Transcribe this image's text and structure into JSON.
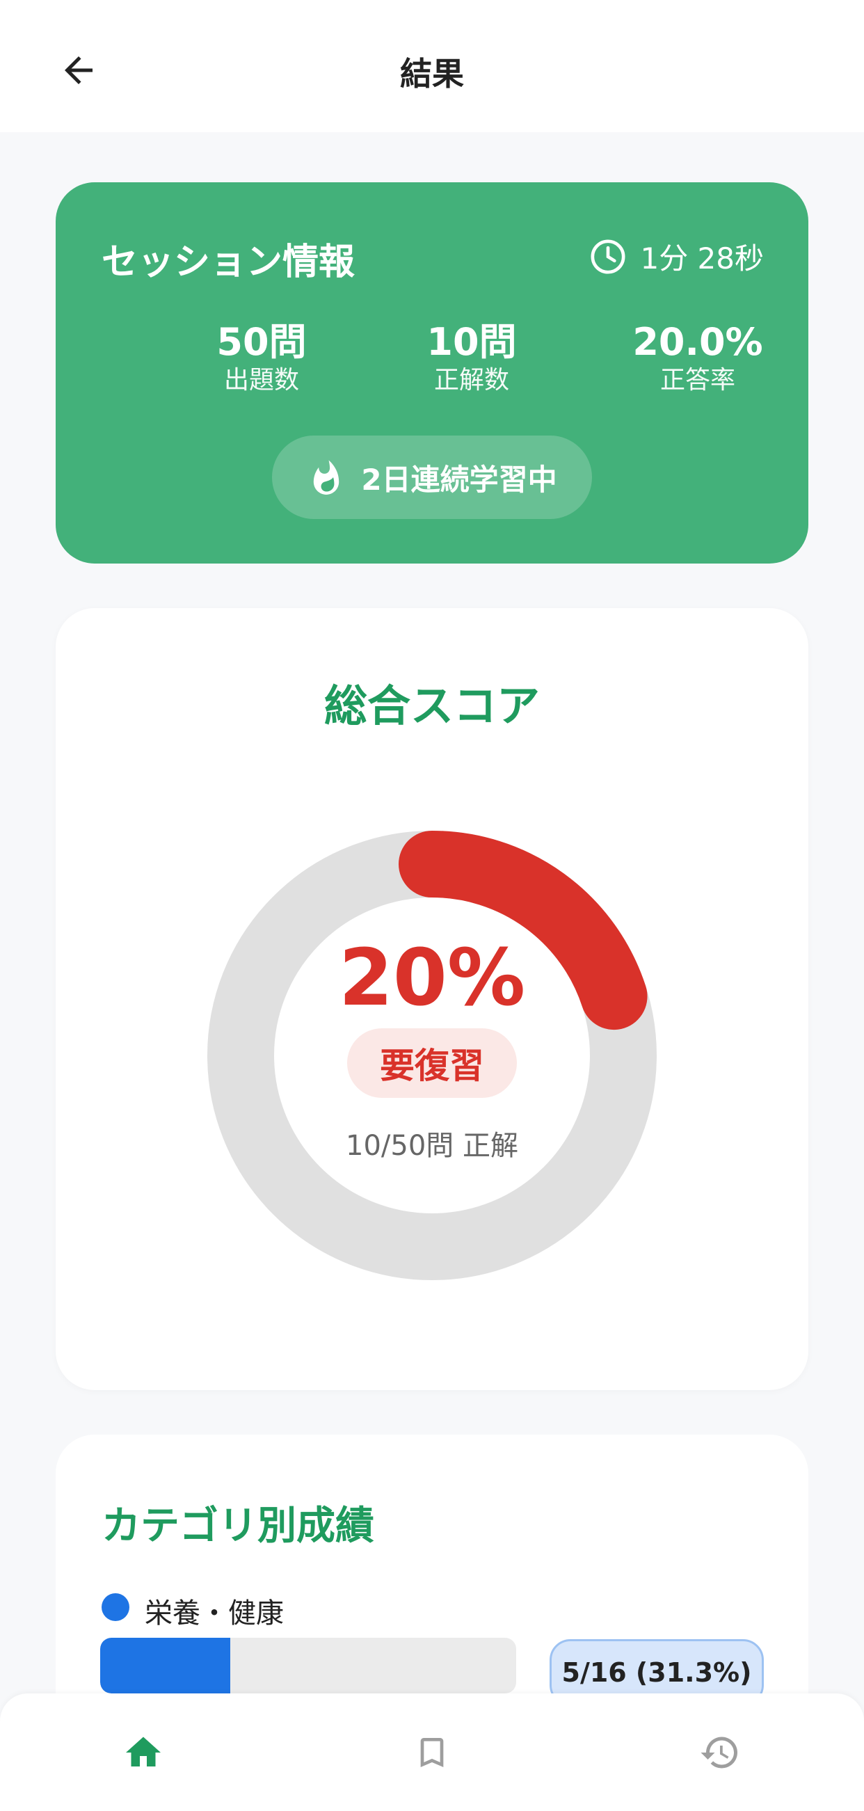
{
  "header": {
    "title": "結果"
  },
  "session": {
    "title": "セッション情報",
    "time": "1分 28秒",
    "stats": [
      {
        "value": "50問",
        "label": "出題数"
      },
      {
        "value": "10問",
        "label": "正解数"
      },
      {
        "value": "20.0%",
        "label": "正答率"
      }
    ],
    "streak": "2日連続学習中"
  },
  "score": {
    "title": "総合スコア",
    "percent_text": "20%",
    "percent": 20,
    "status": "要復習",
    "correct_text": "10/50問 正解"
  },
  "categories": {
    "title": "カテゴリ別成績",
    "items": [
      {
        "name": "栄養・健康",
        "score_text": "5/16 (31.3%)",
        "ratio": 0.313,
        "color": "#1e74e4"
      }
    ]
  },
  "colors": {
    "accent_green": "#43b17a",
    "title_green": "#1f9b5e",
    "danger_red": "#d9322a",
    "category_blue": "#1e74e4"
  },
  "nav": [
    {
      "icon": "home-icon",
      "active": true
    },
    {
      "icon": "bookmark-icon",
      "active": false
    },
    {
      "icon": "history-icon",
      "active": false
    }
  ]
}
